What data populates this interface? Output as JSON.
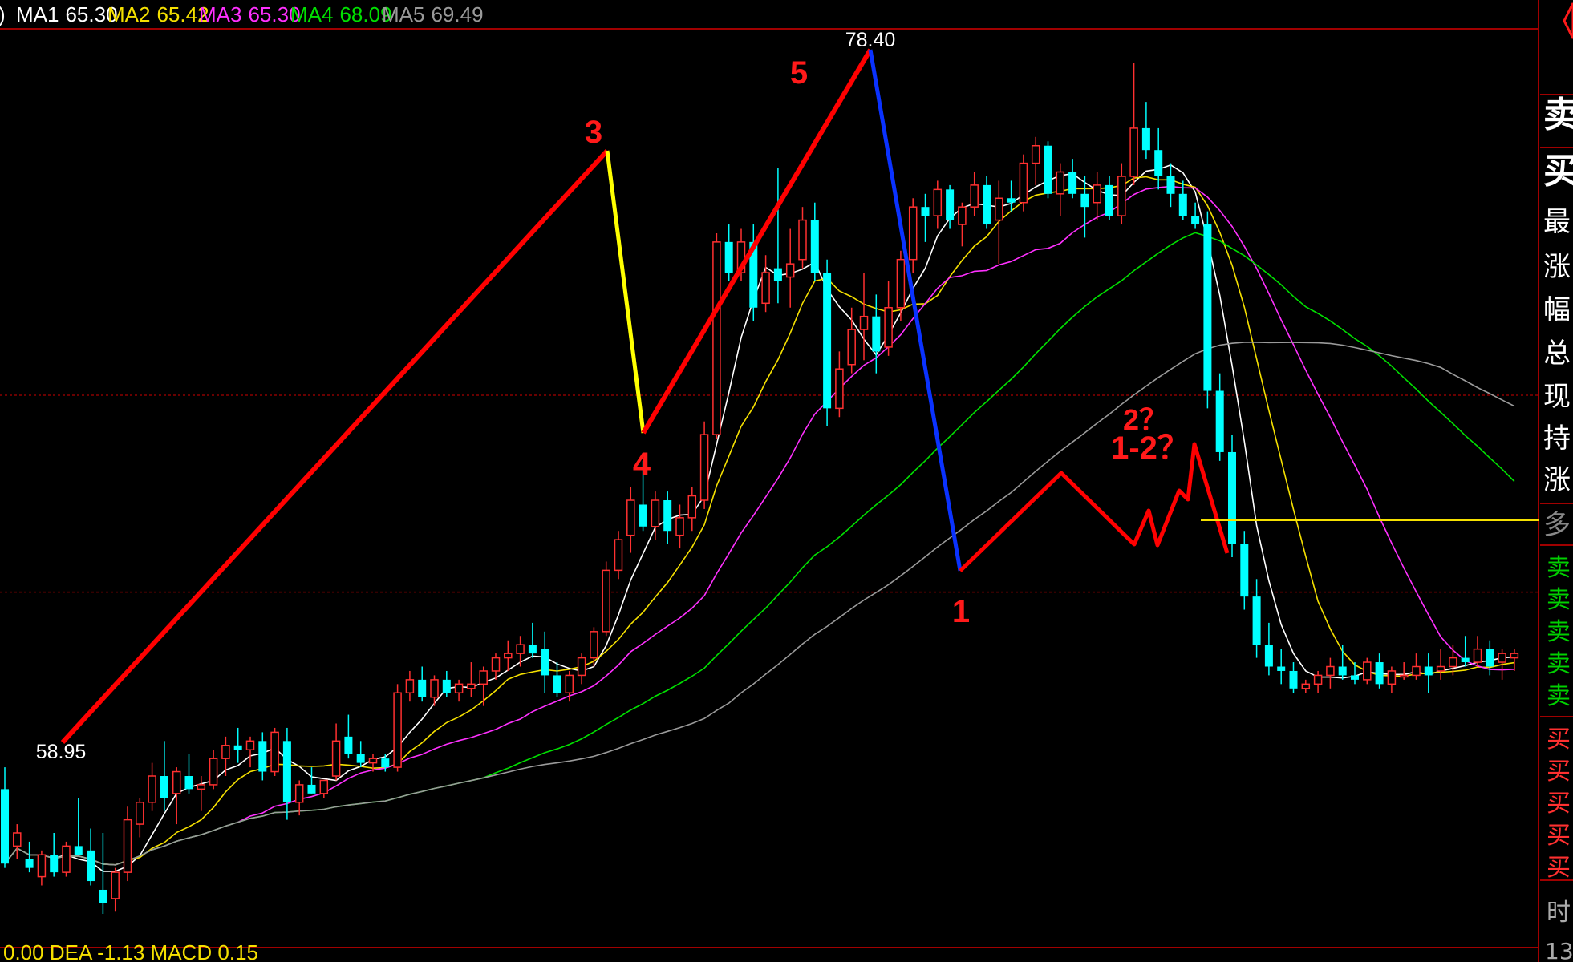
{
  "header": {
    "prefix": ")",
    "ma_items": [
      {
        "label": "MA1",
        "value": "65.30",
        "color": "#ffffff"
      },
      {
        "label": "MA2",
        "value": "65.42",
        "color": "#f5e000"
      },
      {
        "label": "MA3",
        "value": "65.30",
        "color": "#ff30ff"
      },
      {
        "label": "MA4",
        "value": "68.09",
        "color": "#00e000"
      },
      {
        "label": "MA5",
        "value": "69.49",
        "color": "#9a9a9a"
      }
    ]
  },
  "footer": {
    "indicator_text": "0.00   DEA -1.13   MACD 0.15"
  },
  "side_panel": {
    "top_items": [
      "卖",
      "买",
      "最",
      "涨",
      "幅",
      "总",
      "现",
      "持",
      "涨",
      "多"
    ],
    "sell_items": [
      "卖",
      "卖",
      "卖",
      "卖",
      "卖"
    ],
    "buy_items": [
      "买",
      "买",
      "买",
      "买",
      "买"
    ],
    "bottom_items": [
      "时",
      "13"
    ]
  },
  "colors": {
    "up": "#ff3030",
    "down": "#00ffff",
    "wave": "#ff0000",
    "wave_yellow": "#ffff00",
    "wave_blue": "#0a32ff",
    "grid": "#8b0000",
    "border": "#a00000"
  },
  "chart_data": {
    "type": "candlestick",
    "price_range": [
      57.5,
      80.5
    ],
    "max_label": "78.40",
    "min_label": "58.95",
    "max_price": 78.4,
    "min_price": 58.95,
    "candles": [
      [
        61.8,
        62.3,
        60.0,
        60.1
      ],
      [
        60.5,
        61.0,
        60.2,
        60.8
      ],
      [
        60.2,
        60.6,
        59.9,
        60.0
      ],
      [
        59.8,
        60.4,
        59.6,
        60.3
      ],
      [
        60.3,
        60.8,
        59.8,
        59.9
      ],
      [
        59.9,
        60.6,
        59.8,
        60.5
      ],
      [
        60.5,
        61.6,
        60.3,
        60.3
      ],
      [
        60.4,
        60.9,
        59.6,
        59.7
      ],
      [
        59.5,
        60.8,
        58.95,
        59.2
      ],
      [
        59.3,
        60.0,
        59.0,
        59.9
      ],
      [
        59.9,
        61.4,
        59.7,
        61.1
      ],
      [
        61.0,
        61.6,
        60.7,
        61.5
      ],
      [
        61.5,
        62.4,
        61.3,
        62.1
      ],
      [
        62.1,
        62.9,
        61.3,
        61.6
      ],
      [
        61.7,
        62.3,
        61.0,
        62.2
      ],
      [
        62.1,
        62.6,
        61.7,
        61.8
      ],
      [
        61.8,
        62.1,
        61.3,
        61.9
      ],
      [
        61.9,
        62.7,
        61.8,
        62.5
      ],
      [
        62.5,
        63.0,
        62.1,
        62.8
      ],
      [
        62.8,
        63.2,
        62.4,
        62.7
      ],
      [
        62.7,
        63.0,
        62.3,
        62.9
      ],
      [
        62.9,
        63.1,
        62.0,
        62.2
      ],
      [
        62.2,
        63.2,
        62.1,
        63.1
      ],
      [
        62.9,
        63.2,
        61.1,
        61.5
      ],
      [
        61.5,
        62.0,
        61.2,
        61.9
      ],
      [
        61.9,
        62.3,
        61.7,
        61.7
      ],
      [
        61.7,
        62.0,
        61.6,
        62.0
      ],
      [
        62.1,
        63.3,
        62.0,
        62.9
      ],
      [
        63.0,
        63.5,
        62.5,
        62.6
      ],
      [
        62.6,
        62.9,
        62.3,
        62.4
      ],
      [
        62.4,
        62.6,
        62.2,
        62.5
      ],
      [
        62.5,
        62.6,
        62.2,
        62.3
      ],
      [
        62.3,
        64.2,
        62.2,
        64.0
      ],
      [
        64.0,
        64.5,
        63.8,
        64.3
      ],
      [
        64.3,
        64.6,
        63.8,
        63.9
      ],
      [
        63.9,
        64.4,
        63.7,
        64.3
      ],
      [
        64.3,
        64.5,
        63.9,
        64.0
      ],
      [
        64.0,
        64.3,
        63.8,
        64.2
      ],
      [
        64.1,
        64.7,
        63.9,
        64.2
      ],
      [
        64.2,
        64.6,
        63.7,
        64.5
      ],
      [
        64.5,
        64.9,
        64.3,
        64.8
      ],
      [
        64.8,
        65.2,
        64.5,
        64.9
      ],
      [
        64.9,
        65.3,
        64.6,
        65.1
      ],
      [
        65.1,
        65.6,
        64.8,
        64.9
      ],
      [
        65.0,
        65.4,
        64.0,
        64.4
      ],
      [
        64.4,
        64.7,
        63.9,
        64.0
      ],
      [
        64.0,
        64.5,
        63.8,
        64.4
      ],
      [
        64.4,
        64.9,
        64.2,
        64.8
      ],
      [
        64.8,
        65.5,
        64.6,
        65.4
      ],
      [
        65.4,
        67.0,
        65.3,
        66.8
      ],
      [
        66.8,
        67.7,
        66.6,
        67.5
      ],
      [
        67.6,
        68.7,
        67.2,
        68.4
      ],
      [
        68.3,
        69.3,
        67.7,
        67.8
      ],
      [
        67.8,
        68.6,
        67.5,
        68.4
      ],
      [
        68.4,
        68.6,
        67.4,
        67.7
      ],
      [
        67.6,
        68.3,
        67.3,
        68.0
      ],
      [
        68.0,
        68.7,
        67.7,
        68.5
      ],
      [
        68.4,
        70.2,
        68.2,
        69.9
      ],
      [
        69.9,
        74.5,
        69.8,
        74.3
      ],
      [
        74.3,
        74.7,
        73.4,
        73.6
      ],
      [
        73.6,
        74.6,
        73.4,
        74.3
      ],
      [
        74.3,
        74.7,
        72.5,
        72.8
      ],
      [
        72.9,
        74.0,
        72.7,
        73.6
      ],
      [
        73.7,
        76.0,
        72.9,
        73.4
      ],
      [
        73.5,
        74.6,
        72.8,
        73.8
      ],
      [
        73.9,
        75.1,
        73.7,
        74.8
      ],
      [
        74.8,
        75.2,
        73.4,
        73.6
      ],
      [
        73.6,
        73.9,
        70.1,
        70.5
      ],
      [
        70.5,
        71.8,
        70.3,
        71.4
      ],
      [
        71.5,
        72.8,
        71.3,
        72.3
      ],
      [
        72.3,
        73.6,
        71.6,
        72.6
      ],
      [
        72.6,
        73.1,
        71.3,
        71.8
      ],
      [
        71.9,
        73.4,
        71.7,
        72.8
      ],
      [
        72.8,
        74.1,
        72.5,
        73.9
      ],
      [
        73.9,
        75.3,
        73.6,
        75.1
      ],
      [
        75.1,
        75.4,
        74.3,
        74.9
      ],
      [
        74.9,
        75.7,
        74.6,
        75.5
      ],
      [
        75.5,
        75.6,
        74.6,
        74.8
      ],
      [
        74.7,
        75.2,
        74.2,
        75.1
      ],
      [
        75.1,
        75.9,
        74.9,
        75.6
      ],
      [
        75.6,
        75.8,
        74.6,
        74.7
      ],
      [
        74.8,
        75.7,
        73.8,
        75.3
      ],
      [
        75.3,
        75.7,
        75.0,
        75.2
      ],
      [
        75.2,
        76.3,
        75.0,
        76.1
      ],
      [
        76.1,
        76.7,
        75.6,
        76.5
      ],
      [
        76.5,
        76.6,
        75.3,
        75.4
      ],
      [
        75.4,
        76.1,
        74.9,
        75.9
      ],
      [
        75.9,
        76.2,
        75.3,
        75.4
      ],
      [
        75.4,
        75.8,
        74.4,
        75.1
      ],
      [
        75.2,
        75.9,
        74.8,
        75.6
      ],
      [
        75.6,
        75.8,
        74.8,
        74.9
      ],
      [
        74.9,
        76.1,
        74.7,
        75.8
      ],
      [
        75.8,
        78.4,
        75.6,
        76.9
      ],
      [
        76.9,
        77.5,
        76.2,
        76.4
      ],
      [
        76.4,
        76.9,
        75.5,
        75.8
      ],
      [
        75.8,
        76.1,
        75.1,
        75.4
      ],
      [
        75.4,
        75.7,
        74.8,
        74.9
      ],
      [
        74.9,
        75.2,
        74.6,
        74.7
      ],
      [
        74.7,
        75.0,
        70.5,
        70.9
      ],
      [
        70.9,
        71.3,
        69.3,
        69.5
      ],
      [
        69.5,
        69.9,
        67.1,
        67.4
      ],
      [
        67.4,
        67.7,
        65.9,
        66.2
      ],
      [
        66.2,
        66.6,
        64.8,
        65.1
      ],
      [
        65.1,
        65.6,
        64.4,
        64.6
      ],
      [
        64.6,
        65.0,
        64.2,
        64.5
      ],
      [
        64.5,
        64.7,
        64.0,
        64.1
      ],
      [
        64.1,
        64.3,
        64.0,
        64.2
      ],
      [
        64.2,
        64.5,
        64.0,
        64.4
      ],
      [
        64.4,
        64.8,
        64.1,
        64.6
      ],
      [
        64.6,
        65.1,
        64.3,
        64.4
      ],
      [
        64.4,
        64.7,
        64.2,
        64.3
      ],
      [
        64.3,
        64.8,
        64.2,
        64.7
      ],
      [
        64.7,
        64.9,
        64.1,
        64.2
      ],
      [
        64.2,
        64.6,
        64.0,
        64.5
      ],
      [
        64.4,
        64.7,
        64.3,
        64.4
      ],
      [
        64.4,
        64.9,
        64.3,
        64.6
      ],
      [
        64.6,
        64.9,
        64.0,
        64.4
      ],
      [
        64.5,
        65.0,
        64.3,
        64.6
      ],
      [
        64.6,
        65.1,
        64.4,
        64.8
      ],
      [
        64.8,
        65.3,
        64.6,
        64.7
      ],
      [
        64.7,
        65.3,
        64.6,
        65.0
      ],
      [
        65.0,
        65.2,
        64.4,
        64.6
      ],
      [
        64.7,
        65.0,
        64.3,
        64.9
      ],
      [
        64.8,
        65.0,
        64.5,
        64.9
      ]
    ],
    "ma_lines": [
      {
        "name": "MA1",
        "color": "#ffffff",
        "period": 5
      },
      {
        "name": "MA2",
        "color": "#f5e000",
        "period": 10
      },
      {
        "name": "MA3",
        "color": "#ff30ff",
        "period": 20
      },
      {
        "name": "MA4",
        "color": "#00e000",
        "period": 40
      },
      {
        "name": "MA5",
        "color": "#9a9a9a",
        "period": 60
      }
    ],
    "wave_labels": [
      {
        "text": "3",
        "color": "#ff1a1a"
      },
      {
        "text": "4",
        "color": "#ff1a1a"
      },
      {
        "text": "5",
        "color": "#ff1a1a"
      },
      {
        "text": "1",
        "color": "#ff1a1a"
      },
      {
        "text": "2？",
        "color": "#ff1a1a"
      },
      {
        "text": "1-2？",
        "color": "#ff1a1a"
      }
    ],
    "grid_prices": [
      70.8,
      66.3
    ]
  }
}
